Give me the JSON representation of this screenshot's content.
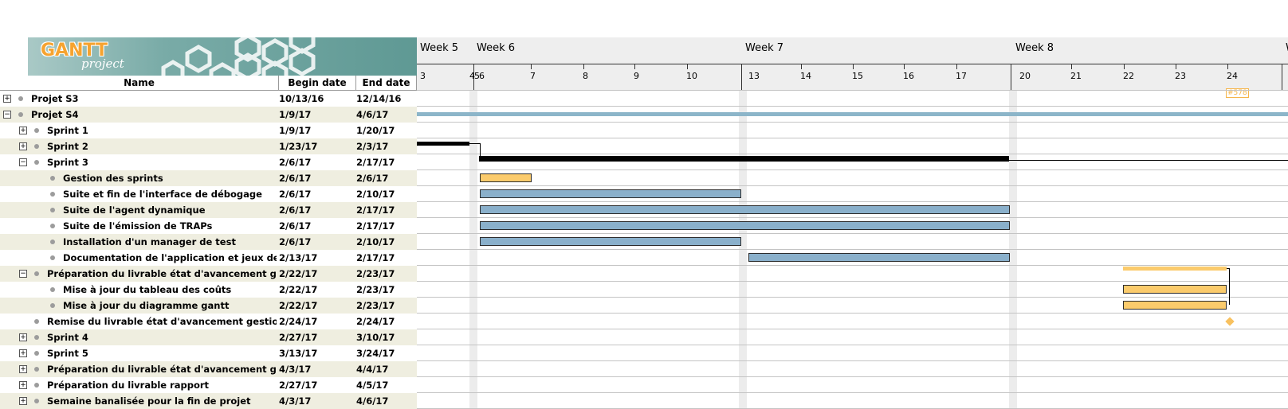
{
  "logo": {
    "title": "GANTT",
    "subtitle": "project"
  },
  "columns": {
    "name": "Name",
    "begin": "Begin date",
    "end": "End date"
  },
  "tasks": [
    {
      "name": "Projet S3",
      "begin": "10/13/16",
      "end": "12/14/16",
      "level": 0,
      "expander": "+"
    },
    {
      "name": "Projet S4",
      "begin": "1/9/17",
      "end": "4/6/17",
      "level": 0,
      "expander": "−"
    },
    {
      "name": "Sprint 1",
      "begin": "1/9/17",
      "end": "1/20/17",
      "level": 1,
      "expander": "+"
    },
    {
      "name": "Sprint 2",
      "begin": "1/23/17",
      "end": "2/3/17",
      "level": 1,
      "expander": "+"
    },
    {
      "name": "Sprint 3",
      "begin": "2/6/17",
      "end": "2/17/17",
      "level": 1,
      "expander": "−"
    },
    {
      "name": "Gestion des sprints",
      "begin": "2/6/17",
      "end": "2/6/17",
      "level": 2,
      "expander": ""
    },
    {
      "name": "Suite et fin de l'interface de débogage",
      "begin": "2/6/17",
      "end": "2/10/17",
      "level": 2,
      "expander": ""
    },
    {
      "name": "Suite de l'agent dynamique",
      "begin": "2/6/17",
      "end": "2/17/17",
      "level": 2,
      "expander": ""
    },
    {
      "name": "Suite de l'émission de TRAPs",
      "begin": "2/6/17",
      "end": "2/17/17",
      "level": 2,
      "expander": ""
    },
    {
      "name": "Installation d'un manager de test",
      "begin": "2/6/17",
      "end": "2/10/17",
      "level": 2,
      "expander": ""
    },
    {
      "name": "Documentation de l'application et jeux de tests",
      "begin": "2/13/17",
      "end": "2/17/17",
      "level": 2,
      "expander": ""
    },
    {
      "name": "Préparation du livrable état d'avancement gestion...",
      "begin": "2/22/17",
      "end": "2/23/17",
      "level": 1,
      "expander": "−"
    },
    {
      "name": "Mise à jour du tableau des coûts",
      "begin": "2/22/17",
      "end": "2/23/17",
      "level": 2,
      "expander": ""
    },
    {
      "name": "Mise à jour du diagramme gantt",
      "begin": "2/22/17",
      "end": "2/23/17",
      "level": 2,
      "expander": ""
    },
    {
      "name": "Remise du livrable état d'avancement gestion de ...",
      "begin": "2/24/17",
      "end": "2/24/17",
      "level": 1,
      "expander": ""
    },
    {
      "name": "Sprint 4",
      "begin": "2/27/17",
      "end": "3/10/17",
      "level": 1,
      "expander": "+"
    },
    {
      "name": "Sprint 5",
      "begin": "3/13/17",
      "end": "3/24/17",
      "level": 1,
      "expander": "+"
    },
    {
      "name": "Préparation du livrable état d'avancement gestion...",
      "begin": "4/3/17",
      "end": "4/4/17",
      "level": 1,
      "expander": "+"
    },
    {
      "name": "Préparation du livrable rapport",
      "begin": "2/27/17",
      "end": "4/5/17",
      "level": 1,
      "expander": "+"
    },
    {
      "name": "Semaine banalisée pour la fin de projet",
      "begin": "4/3/17",
      "end": "4/6/17",
      "level": 1,
      "expander": "+"
    }
  ],
  "timeline": {
    "weeks": [
      "Week 5",
      "Week 6",
      "Week 7",
      "Week 8",
      "W"
    ],
    "days": [
      "3",
      "4",
      "5",
      "6",
      "7",
      "8",
      "9",
      "10",
      "13",
      "14",
      "15",
      "16",
      "17",
      "20",
      "21",
      "22",
      "23",
      "24"
    ]
  },
  "milestone_tag": "#578",
  "colors": {
    "task_blue": "#8ab0cb",
    "task_yellow": "#fbcb6c",
    "summary": "#000000",
    "alt_row": "#efeee0",
    "project_line": "#8cb5c9"
  }
}
